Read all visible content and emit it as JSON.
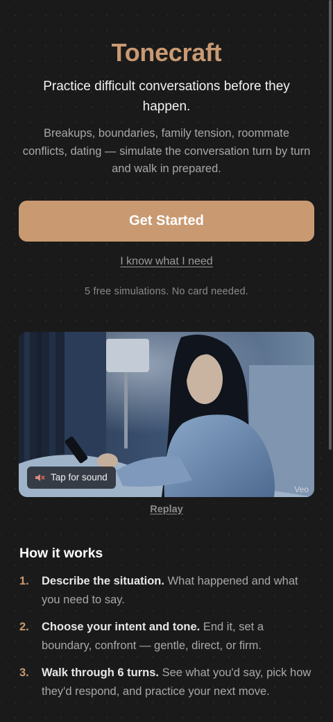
{
  "app": {
    "brand": "Tonecraft",
    "tagline": "Practice difficult conversations before they happen.",
    "description": "Breakups, boundaries, family tension, roommate conflicts, dating — simulate the conversation turn by turn and walk in prepared."
  },
  "actions": {
    "get_started_label": "Get Started",
    "know_what_i_need_label": "I know what I need",
    "free_note": "5 free simulations. No card needed."
  },
  "video": {
    "sound_label": "Tap for sound",
    "sound_icon": "muted-speaker-icon",
    "badge": "Veo",
    "replay_label": "Replay"
  },
  "how_it_works": {
    "title": "How it works",
    "steps": [
      {
        "num": "1.",
        "bold": "Describe the situation.",
        "text": "What happened and what you need to say."
      },
      {
        "num": "2.",
        "bold": "Choose your intent and tone.",
        "text": "End it, set a boundary, confront — gentle, direct, or firm."
      },
      {
        "num": "3.",
        "bold": "Walk through 6 turns.",
        "text": "See what you'd say, pick how they'd respond, and practice your next move."
      }
    ]
  },
  "colors": {
    "accent": "#c99a72",
    "background": "#1a1a1a",
    "text_primary": "#f2f2f2",
    "text_muted": "#a8a8a8"
  }
}
